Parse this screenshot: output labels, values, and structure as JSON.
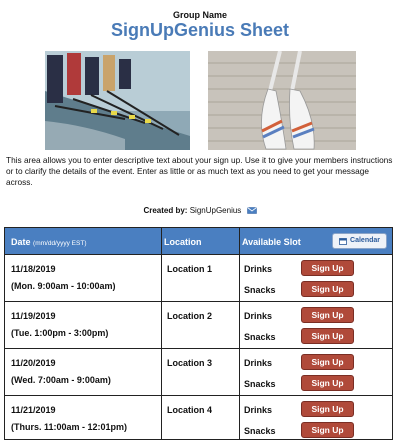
{
  "header": {
    "group_name": "Group Name",
    "title": "SignUpGenius Sheet"
  },
  "images": {
    "left": "rowing-team-photo",
    "right": "oars-on-dock-photo"
  },
  "description": "This area allows you to enter descriptive text about your sign up. Use it to give your members instructions or to clarify the details of the event. Enter as little or as much text as you need to get your message across.",
  "created_by": {
    "label": "Created by:",
    "name": "SignUpGenius",
    "icon": "mail-icon"
  },
  "table": {
    "headers": {
      "date": "Date",
      "date_format": "(mm/dd/yyyy EST)",
      "location": "Location",
      "slot": "Available Slot",
      "calendar_button": "Calendar"
    },
    "rows": [
      {
        "date": "11/18/2019",
        "time": "(Mon. 9:00am - 10:00am)",
        "location": "Location 1",
        "slots": [
          {
            "name": "Drinks",
            "button": "Sign Up"
          },
          {
            "name": "Snacks",
            "button": "Sign Up"
          }
        ]
      },
      {
        "date": "11/19/2019",
        "time": "(Tue. 1:00pm - 3:00pm)",
        "location": "Location 2",
        "slots": [
          {
            "name": "Drinks",
            "button": "Sign Up"
          },
          {
            "name": "Snacks",
            "button": "Sign Up"
          }
        ]
      },
      {
        "date": "11/20/2019",
        "time": "(Wed. 7:00am - 9:00am)",
        "location": "Location 3",
        "slots": [
          {
            "name": "Drinks",
            "button": "Sign Up"
          },
          {
            "name": "Snacks",
            "button": "Sign Up"
          }
        ]
      },
      {
        "date": "11/21/2019",
        "time": "(Thurs. 11:00am - 12:01pm)",
        "location": "Location 4",
        "slots": [
          {
            "name": "Drinks",
            "button": "Sign Up"
          },
          {
            "name": "Snacks",
            "button": "Sign Up"
          }
        ]
      }
    ]
  },
  "colors": {
    "title": "#4a7bb7",
    "header_bar": "#4a7fc1",
    "signup_button": "#b04a3a"
  }
}
